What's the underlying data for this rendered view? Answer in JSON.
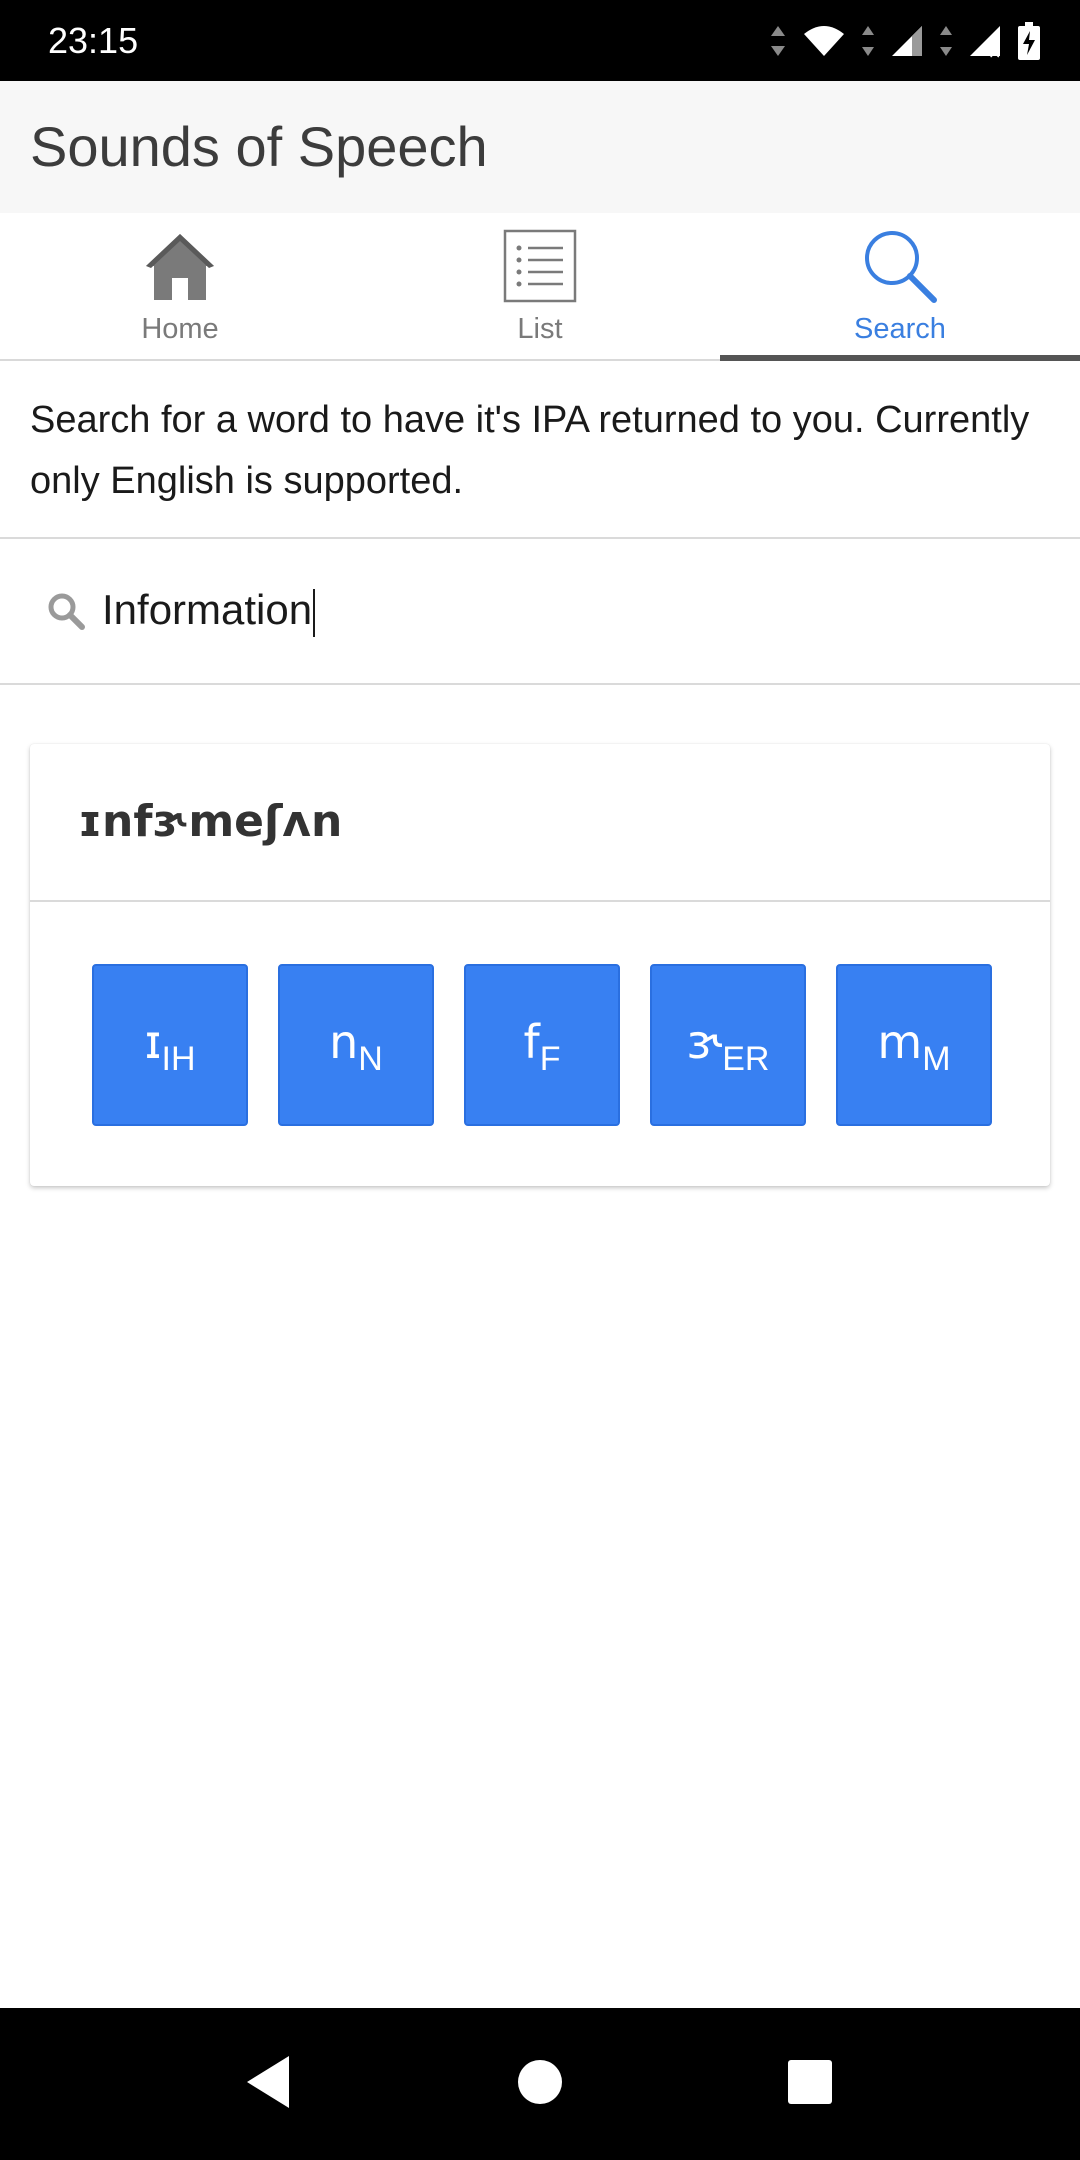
{
  "status_bar": {
    "time": "23:15",
    "icons": [
      "data-arrows-icon",
      "wifi-icon",
      "signal-icon",
      "signal-no-data-icon",
      "battery-charging-icon"
    ]
  },
  "app": {
    "title": "Sounds of Speech"
  },
  "tabs": [
    {
      "label": "Home",
      "icon": "home-icon",
      "active": false
    },
    {
      "label": "List",
      "icon": "list-icon",
      "active": false
    },
    {
      "label": "Search",
      "icon": "search-icon",
      "active": true
    }
  ],
  "search": {
    "description": "Search for a word to have it's IPA returned to you. Currently only English is supported.",
    "value": "Information",
    "icon": "search-icon"
  },
  "result": {
    "ipa": "ɪnfɝmeʃʌn",
    "phonemes": [
      {
        "symbol": "ɪ",
        "code": "IH"
      },
      {
        "symbol": "n",
        "code": "N"
      },
      {
        "symbol": "f",
        "code": "F"
      },
      {
        "symbol": "ɝ",
        "code": "ER"
      },
      {
        "symbol": "m",
        "code": "M"
      }
    ]
  },
  "navigation": {
    "buttons": [
      "back-icon",
      "home-circle-icon",
      "recents-icon"
    ]
  },
  "colors": {
    "accent": "#3a7fe0",
    "phoneme_button": "#3880f2",
    "app_bar": "#f7f7f7",
    "tab_indicator": "#555555"
  }
}
